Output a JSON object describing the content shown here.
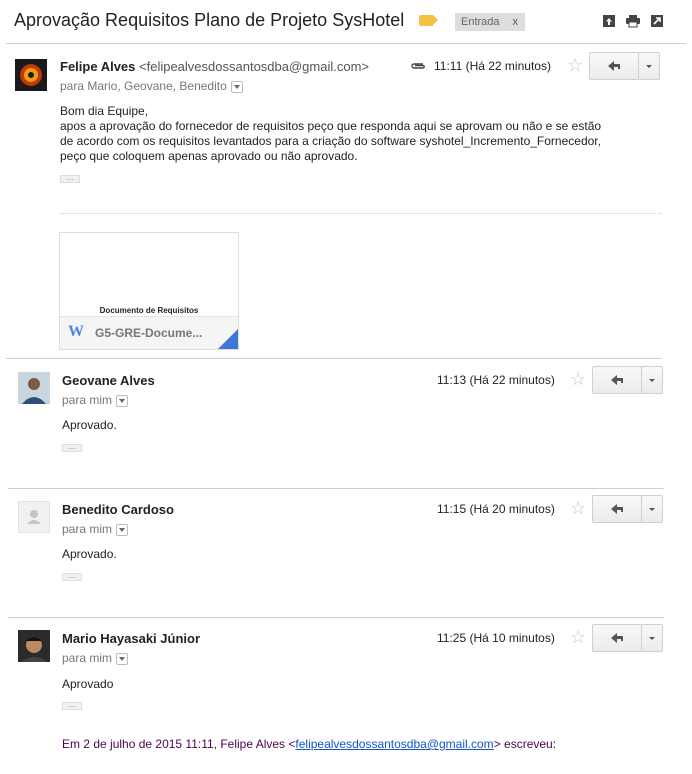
{
  "thread": {
    "subject": "Aprovação Requisitos Plano de Projeto SysHotel",
    "label_chip": "Entrada",
    "label_chip_close": "x",
    "label_color": "#f6c142"
  },
  "toolbar_icons": [
    "open-in-new-window-icon",
    "print-icon",
    "expand-icon"
  ],
  "messages": [
    {
      "sender": "Felipe Alves",
      "email": "<felipealvesdossantosdba@gmail.com>",
      "to": "para Mario, Geovane, Benedito",
      "time": "11:11 (Há 22 minutos)",
      "has_attachment": true,
      "body": [
        "Bom dia Equipe,",
        "apos a aprovação do fornecedor de requisitos peço que responda aqui se aprovam ou não e se estão",
        "de acordo com os requisitos levantados para a criação do software syshotel_Incremento_Fornecedor,",
        "peço que coloquem apenas aprovado ou não aprovado."
      ],
      "attachment": {
        "preview_title": "Documento de Requisitos",
        "name": "G5-GRE-Docume...",
        "type_icon": "W"
      }
    },
    {
      "sender": "Geovane Alves",
      "to": "para mim",
      "time": "11:13 (Há 22 minutos)",
      "body": [
        "Aprovado."
      ]
    },
    {
      "sender": "Benedito Cardoso",
      "to": "para mim",
      "time": "11:15 (Há 20 minutos)",
      "body": [
        "Aprovado."
      ]
    },
    {
      "sender": "Mario Hayasaki Júnior",
      "to": "para mim",
      "time": "11:25 (Há 10 minutos)",
      "body": [
        "Aprovado"
      ],
      "quote": {
        "prefix": "Em 2 de julho de 2015 11:11, Felipe Alves <",
        "email": "felipealvesdossantosdba@gmail.com",
        "suffix": "> escreveu:"
      }
    }
  ],
  "colors": {
    "link": "#1155cc",
    "quote_text": "#500050",
    "word_icon": "#4a86e8"
  }
}
